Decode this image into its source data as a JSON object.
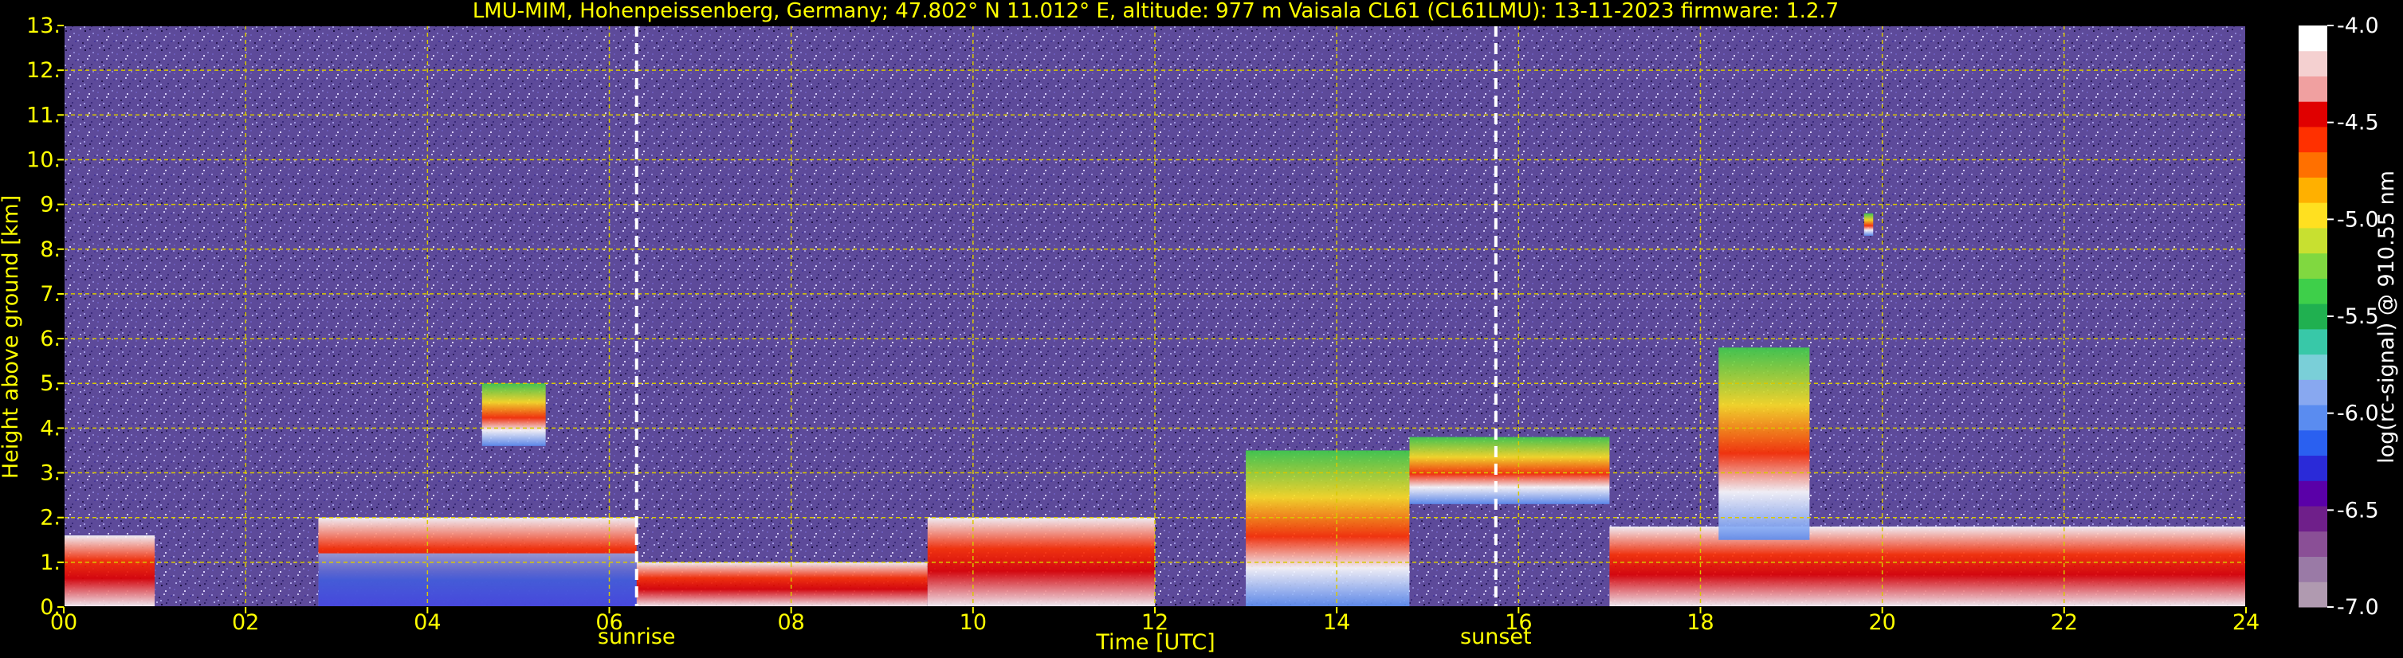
{
  "chart_data": {
    "type": "heatmap",
    "title": "LMU-MIM, Hohenpeissenberg, Germany; 47.802° N 11.012° E, altitude: 977 m    Vaisala CL61 (CL61LMU): 13-11-2023    firmware: 1.2.7",
    "xlabel": "Time [UTC]",
    "ylabel": "Height above ground [km]",
    "xlim": [
      0,
      24
    ],
    "ylim": [
      0,
      13
    ],
    "x_ticks": [
      0,
      2,
      4,
      6,
      8,
      10,
      12,
      14,
      16,
      18,
      20,
      22,
      24
    ],
    "x_tick_labels": [
      "00",
      "02",
      "04",
      "06",
      "08",
      "10",
      "12",
      "14",
      "16",
      "18",
      "20",
      "22",
      "24"
    ],
    "y_ticks": [
      0,
      1,
      2,
      3,
      4,
      5,
      6,
      7,
      8,
      9,
      10,
      11,
      12,
      13
    ],
    "y_tick_labels": [
      "0.",
      "1.",
      "2.",
      "3.",
      "4.",
      "5.",
      "6.",
      "7.",
      "8.",
      "9.",
      "10.",
      "11.",
      "12.",
      "13."
    ],
    "grid": true,
    "markers": [
      {
        "label": "sunrise",
        "x": 6.3
      },
      {
        "label": "sunset",
        "x": 15.75
      }
    ],
    "colorbar": {
      "label": "log(rc-signal) @ 910.55 nm",
      "range": [
        -7.0,
        -4.0
      ],
      "ticks": [
        -4.0,
        -4.5,
        -5.0,
        -5.5,
        -6.0,
        -6.5,
        -7.0
      ],
      "tick_labels": [
        "-4.0",
        "-4.5",
        "-5.0",
        "-5.5",
        "-6.0",
        "-6.5",
        "-7.0"
      ],
      "colors": [
        "#b09ab0",
        "#9a7aa6",
        "#8a4f96",
        "#6f1f8a",
        "#5a00a8",
        "#2a2ad8",
        "#2a60f0",
        "#5a8cf0",
        "#88a8f0",
        "#7acfd8",
        "#38c8a8",
        "#20b050",
        "#3ecf4a",
        "#80d840",
        "#c8e030",
        "#ffe020",
        "#ffb000",
        "#ff7000",
        "#ff3000",
        "#e00000",
        "#f0a0a0",
        "#f4d0d0",
        "#ffffff"
      ]
    },
    "regions": [
      {
        "kind": "aerosol_layer",
        "x": [
          0.0,
          1.0
        ],
        "y": [
          0.0,
          1.6
        ]
      },
      {
        "kind": "aerosol_layer",
        "x": [
          2.8,
          6.3
        ],
        "y": [
          0.0,
          2.0
        ]
      },
      {
        "kind": "cloud",
        "x": [
          4.6,
          5.3
        ],
        "y": [
          3.6,
          5.0
        ]
      },
      {
        "kind": "aerosol_layer",
        "x": [
          6.3,
          9.5
        ],
        "y": [
          0.0,
          1.0
        ]
      },
      {
        "kind": "aerosol_layer",
        "x": [
          9.5,
          12.0
        ],
        "y": [
          0.0,
          2.0
        ]
      },
      {
        "kind": "cloud",
        "x": [
          13.0,
          14.8
        ],
        "y": [
          0.0,
          3.5
        ]
      },
      {
        "kind": "cloud",
        "x": [
          14.8,
          17.0
        ],
        "y": [
          2.3,
          3.8
        ]
      },
      {
        "kind": "aerosol_layer",
        "x": [
          17.0,
          24.0
        ],
        "y": [
          0.0,
          1.8
        ]
      },
      {
        "kind": "cloud",
        "x": [
          18.2,
          19.2
        ],
        "y": [
          1.5,
          5.8
        ]
      },
      {
        "kind": "cloud",
        "x": [
          19.8,
          19.9
        ],
        "y": [
          8.3,
          8.8
        ]
      }
    ]
  }
}
